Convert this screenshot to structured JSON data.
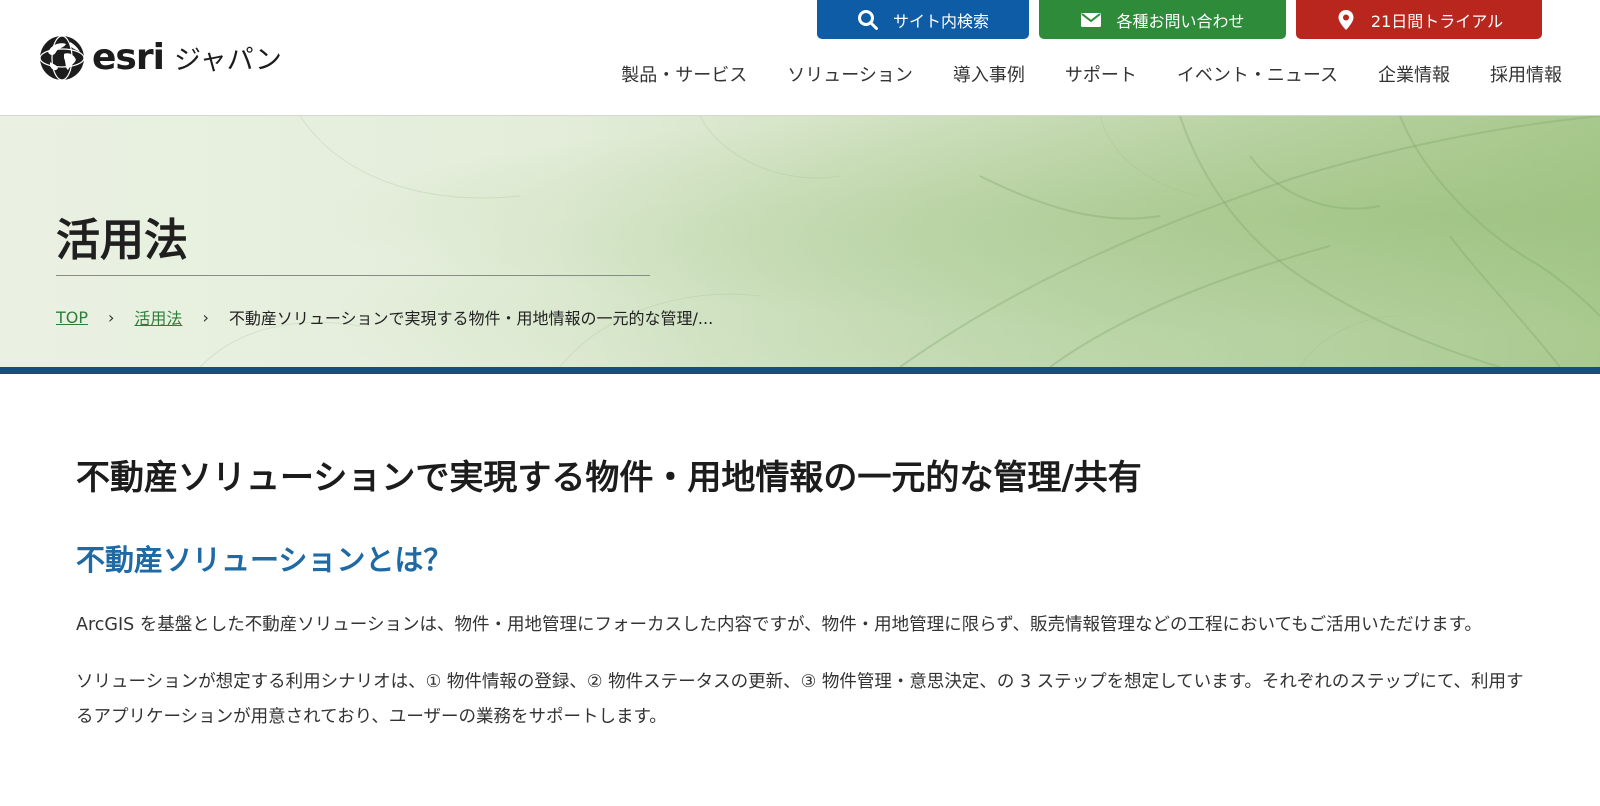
{
  "logo": {
    "word": "esri",
    "sub": "ジャパン"
  },
  "utility": {
    "search_label": "サイト内検索",
    "contact_label": "各種お問い合わせ",
    "trial_label": "21日間トライアル"
  },
  "nav": {
    "items": [
      {
        "label": "製品・サービス"
      },
      {
        "label": "ソリューション"
      },
      {
        "label": "導入事例"
      },
      {
        "label": "サポート"
      },
      {
        "label": "イベント・ニュース"
      },
      {
        "label": "企業情報"
      },
      {
        "label": "採用情報"
      }
    ]
  },
  "hero": {
    "title": "活用法",
    "breadcrumb": {
      "top": "TOP",
      "section": "活用法",
      "current": "不動産ソリューションで実現する物件・用地情報の一元的な管理/..."
    }
  },
  "content": {
    "title": "不動産ソリューションで実現する物件・用地情報の一元的な管理/共有",
    "section_heading": "不動産ソリューションとは？",
    "paragraphs": [
      "ArcGIS を基盤とした不動産ソリューションは、物件・用地管理にフォーカスした内容ですが、物件・用地管理に限らず、販売情報管理などの工程においてもご活用いただけます。",
      "ソリューションが想定する利用シナリオは、① 物件情報の登録、② 物件ステータスの更新、③ 物件管理・意思決定、の 3 ステップを想定しています。それぞれのステップにて、利用するアプリケーションが用意されており、ユーザーの業務をサポートします。"
    ]
  },
  "colors": {
    "search_button": "#0e5ca6",
    "contact_button": "#2e8b3a",
    "trial_button": "#b8261e",
    "band": "#1a4d7a",
    "heading": "#1f6aa5",
    "link": "#2f7d3a"
  },
  "icons": {
    "search": "search-icon",
    "contact": "mail-icon",
    "trial": "location-pin-icon",
    "breadcrumb_sep": "chevron-right-icon",
    "logo": "globe-icon"
  }
}
